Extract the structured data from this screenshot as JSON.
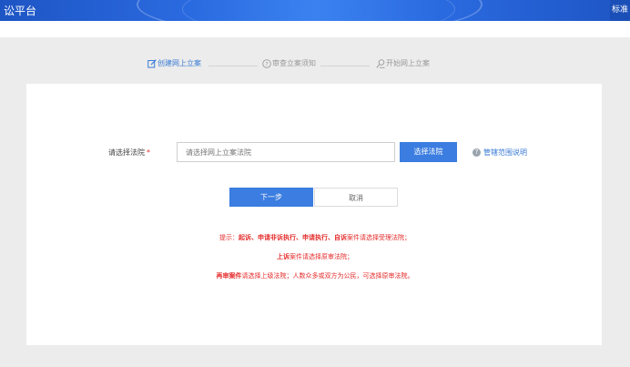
{
  "header": {
    "title": "讼平台",
    "right_badge": "标准"
  },
  "steps": [
    {
      "label": "创建网上立案",
      "icon": "edit-icon",
      "active": true
    },
    {
      "label": "审查立案须知",
      "icon": "question-circle-icon",
      "active": false
    },
    {
      "label": "开始网上立案",
      "icon": "search-person-icon",
      "active": false
    }
  ],
  "form": {
    "court_label": "请选择法院",
    "required_mark": "*",
    "court_placeholder": "请选择网上立案法院",
    "select_button": "选择法院",
    "scope_link": "管辖范围说明"
  },
  "actions": {
    "next": "下一步",
    "cancel": "取消"
  },
  "hints": {
    "line1_prefix": "提示：",
    "line1_bold": "起诉、申请非诉执行、申请执行、自诉",
    "line1_suffix": "案件请选择受理法院；",
    "line2_bold": "上诉",
    "line2_suffix": "案件请选择原审法院；",
    "line3_bold": "再审案件",
    "line3_suffix": "请选择上级法院；人数众多或双方为公民，可选择原审法院。"
  },
  "colors": {
    "primary": "#3b7de0",
    "required": "#e52b2b",
    "header": "#2a6ae0"
  }
}
